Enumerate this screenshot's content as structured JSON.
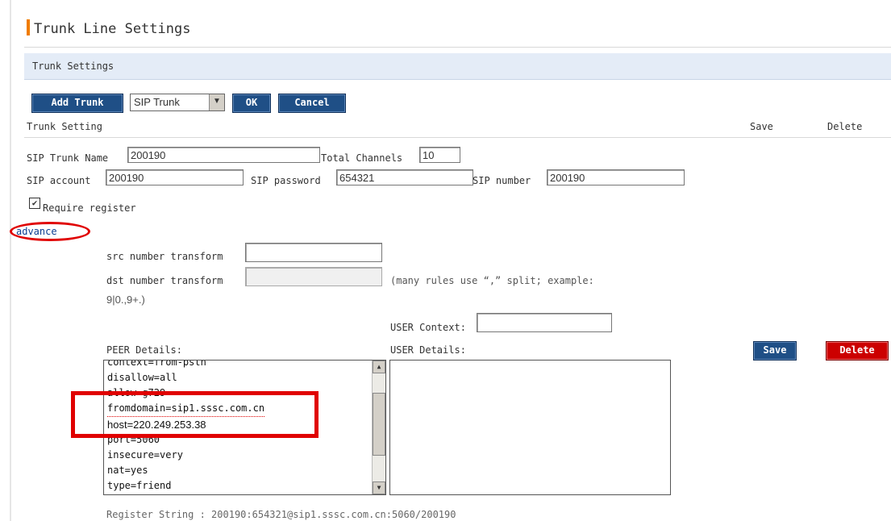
{
  "page": {
    "title": "Trunk Line Settings",
    "section": "Trunk Settings"
  },
  "toolbar": {
    "add_trunk": "Add Trunk",
    "trunk_type": "SIP Trunk",
    "ok": "OK",
    "cancel": "Cancel"
  },
  "table_header": {
    "trunk_setting": "Trunk Setting",
    "save": "Save",
    "delete": "Delete"
  },
  "form": {
    "sip_trunk_name_label": "SIP Trunk Name",
    "sip_trunk_name": "200190",
    "total_channels_label": "Total Channels",
    "total_channels": "10",
    "sip_account_label": "SIP account",
    "sip_account": "200190",
    "sip_password_label": "SIP password",
    "sip_password": "654321",
    "sip_number_label": "SIP number",
    "sip_number": "200190",
    "require_register_label": "Require register",
    "require_register_checked": true,
    "advance_link": "advance"
  },
  "advanced": {
    "src_transform_label": "src number transform",
    "src_transform": "",
    "dst_transform_label": "dst number transform",
    "dst_transform": "",
    "hint": "(many rules use “,” split; example:",
    "hint_example": "9|0.,9+.)",
    "user_context_label": "USER Context:",
    "user_context": "",
    "peer_details_label": "PEER Details:",
    "user_details_label": "USER Details:",
    "save": "Save",
    "delete": "Delete",
    "peer_lines": [
      "context=from-pstn",
      "disallow=all",
      "allow=g729",
      "fromdomain=sip1.sssc.com.cn",
      "host=220.249.253.38",
      "port=5060",
      "insecure=very",
      "nat=yes",
      "type=friend"
    ],
    "register_string": "Register String : 200190:654321@sip1.sssc.com.cn:5060/200190"
  },
  "colors": {
    "accent_orange": "#f07c00",
    "button_blue": "#1f4f86",
    "delete_red": "#cc0000",
    "annotation_red": "#e00000",
    "section_bg": "#e4ecf7"
  }
}
